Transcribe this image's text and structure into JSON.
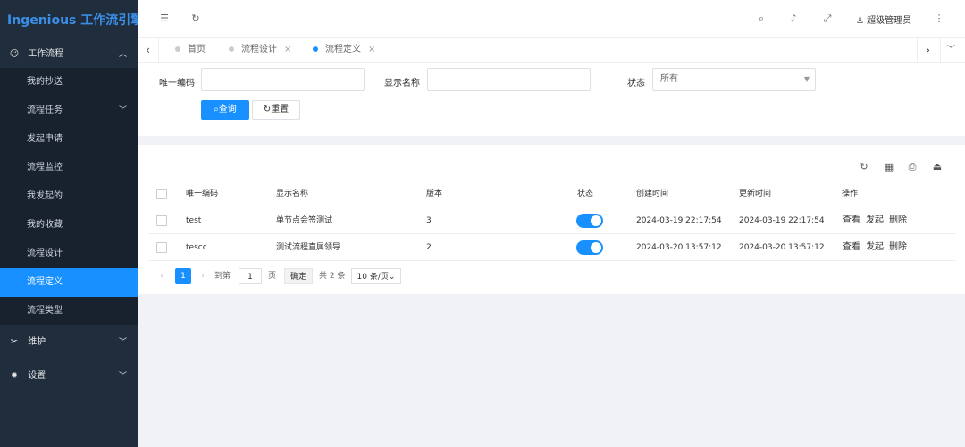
{
  "app": {
    "title": "Ingenious 工作流引擎"
  },
  "sidebar": {
    "groups": [
      {
        "label": "工作流程",
        "icon": "smile-icon",
        "items": [
          {
            "label": "我的抄送"
          },
          {
            "label": "流程任务"
          },
          {
            "label": "发起申请"
          },
          {
            "label": "流程监控"
          },
          {
            "label": "我发起的"
          },
          {
            "label": "我的收藏"
          },
          {
            "label": "流程设计"
          },
          {
            "label": "流程定义"
          },
          {
            "label": "流程类型"
          }
        ]
      },
      {
        "label": "维护",
        "icon": "tools-icon"
      },
      {
        "label": "设置",
        "icon": "gear-icon"
      }
    ],
    "active_item": "流程定义"
  },
  "header": {
    "user": "超级管理员"
  },
  "tabs": [
    {
      "label": "首页"
    },
    {
      "label": "流程设计"
    },
    {
      "label": "流程定义"
    }
  ],
  "search": {
    "code_label": "唯一编码",
    "code_value": "",
    "name_label": "显示名称",
    "name_value": "",
    "status_label": "状态",
    "status_value": "所有",
    "query_button": "查询",
    "reset_button": "重置"
  },
  "table": {
    "columns": [
      "唯一编码",
      "显示名称",
      "版本",
      "状态",
      "创建时间",
      "更新时间",
      "操作"
    ],
    "rows": [
      {
        "code": "test",
        "name": "单节点会签测试",
        "version": "3",
        "enabled": true,
        "created": "2024-03-19 22:17:54",
        "updated": "2024-03-19 22:17:54"
      },
      {
        "code": "tescc",
        "name": "测试流程直属领导",
        "version": "2",
        "enabled": true,
        "created": "2024-03-20 13:57:12",
        "updated": "2024-03-20 13:57:12"
      }
    ],
    "actions": [
      "查看",
      "发起",
      "删除"
    ]
  },
  "pagination": {
    "current_page": "1",
    "goto_label": "到第",
    "page_input": "1",
    "page_suffix": "页",
    "confirm": "确定",
    "total": "共 2 条",
    "page_size": "10 条/页"
  },
  "colors": {
    "primary": "#1890ff",
    "sidebar_bg": "#1f2d3d",
    "logo": "#3a8ee6"
  }
}
